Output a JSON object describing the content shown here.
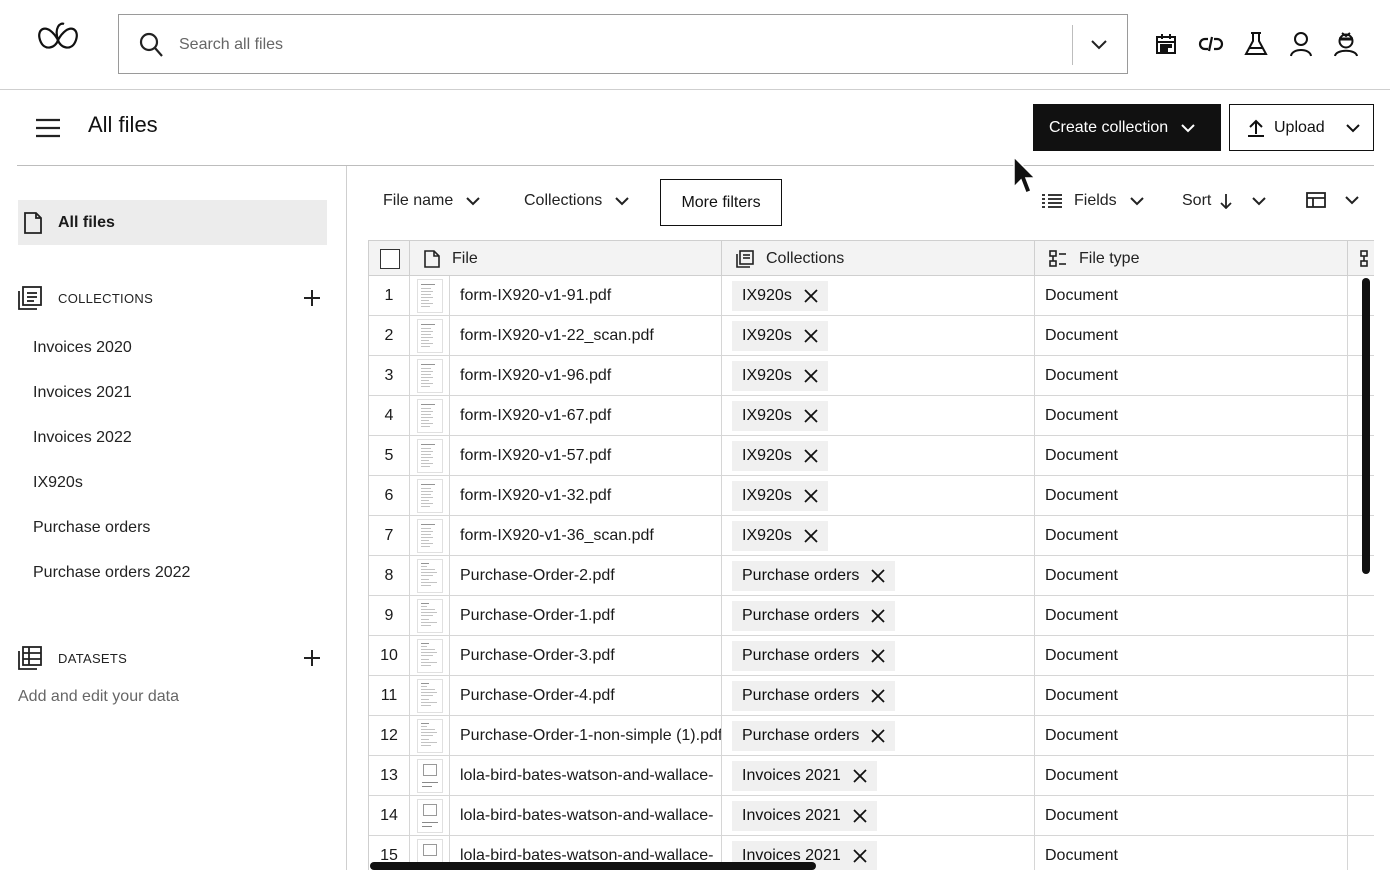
{
  "search": {
    "placeholder": "Search all files"
  },
  "top_icons": [
    "calendar-icon",
    "link-icon",
    "flask-icon",
    "user-icon",
    "agent-icon"
  ],
  "header": {
    "title": "All files",
    "create_label": "Create collection",
    "upload_label": "Upload"
  },
  "sidebar": {
    "all_files": "All files",
    "collections_title": "COLLECTIONS",
    "collections": [
      "Invoices 2020",
      "Invoices 2021",
      "Invoices 2022",
      "IX920s",
      "Purchase orders",
      "Purchase orders 2022"
    ],
    "datasets_title": "DATASETS",
    "datasets_desc": "Add and edit your data"
  },
  "filters": {
    "file_name": "File name",
    "collections": "Collections",
    "more": "More filters",
    "fields": "Fields",
    "sort": "Sort"
  },
  "table": {
    "columns": [
      "File",
      "Collections",
      "File type"
    ],
    "rows": [
      {
        "num": "1",
        "file": "form-IX920-v1-91.pdf",
        "collection": "IX920s",
        "type": "Document",
        "thumb": "form"
      },
      {
        "num": "2",
        "file": "form-IX920-v1-22_scan.pdf",
        "collection": "IX920s",
        "type": "Document",
        "thumb": "form"
      },
      {
        "num": "3",
        "file": "form-IX920-v1-96.pdf",
        "collection": "IX920s",
        "type": "Document",
        "thumb": "form"
      },
      {
        "num": "4",
        "file": "form-IX920-v1-67.pdf",
        "collection": "IX920s",
        "type": "Document",
        "thumb": "form"
      },
      {
        "num": "5",
        "file": "form-IX920-v1-57.pdf",
        "collection": "IX920s",
        "type": "Document",
        "thumb": "form"
      },
      {
        "num": "6",
        "file": "form-IX920-v1-32.pdf",
        "collection": "IX920s",
        "type": "Document",
        "thumb": "form"
      },
      {
        "num": "7",
        "file": "form-IX920-v1-36_scan.pdf",
        "collection": "IX920s",
        "type": "Document",
        "thumb": "form"
      },
      {
        "num": "8",
        "file": "Purchase-Order-2.pdf",
        "collection": "Purchase orders",
        "type": "Document",
        "thumb": "po"
      },
      {
        "num": "9",
        "file": "Purchase-Order-1.pdf",
        "collection": "Purchase orders",
        "type": "Document",
        "thumb": "po"
      },
      {
        "num": "10",
        "file": "Purchase-Order-3.pdf",
        "collection": "Purchase orders",
        "type": "Document",
        "thumb": "po"
      },
      {
        "num": "11",
        "file": "Purchase-Order-4.pdf",
        "collection": "Purchase orders",
        "type": "Document",
        "thumb": "po"
      },
      {
        "num": "12",
        "file": "Purchase-Order-1-non-simple (1).pdf",
        "collection": "Purchase orders",
        "type": "Document",
        "thumb": "po"
      },
      {
        "num": "13",
        "file": "lola-bird-bates-watson-and-wallace-",
        "collection": "Invoices 2021",
        "type": "Document",
        "thumb": "invoice"
      },
      {
        "num": "14",
        "file": "lola-bird-bates-watson-and-wallace-",
        "collection": "Invoices 2021",
        "type": "Document",
        "thumb": "invoice"
      },
      {
        "num": "15",
        "file": "lola-bird-bates-watson-and-wallace-",
        "collection": "Invoices 2021",
        "type": "Document",
        "thumb": "invoice"
      }
    ]
  }
}
